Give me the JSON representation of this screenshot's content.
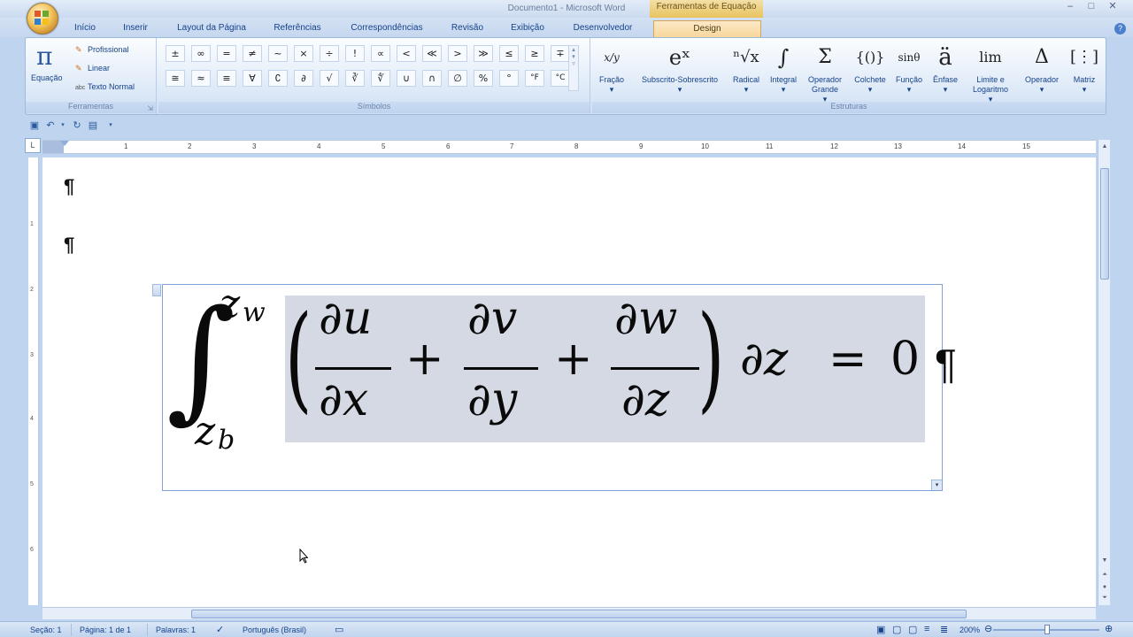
{
  "window": {
    "title": "Documento1 - Microsoft Word",
    "contextual_header": "Ferramentas de Equação",
    "controls": [
      "–",
      "□",
      "✕"
    ]
  },
  "tabs": [
    {
      "label": "Início"
    },
    {
      "label": "Inserir"
    },
    {
      "label": "Layout da Página"
    },
    {
      "label": "Referências"
    },
    {
      "label": "Correspondências"
    },
    {
      "label": "Revisão"
    },
    {
      "label": "Exibição"
    },
    {
      "label": "Desenvolvedor"
    },
    {
      "label": "Design"
    }
  ],
  "ribbon": {
    "tools": {
      "group_label": "Ferramentas",
      "equation_label": "Equação",
      "professional_label": "Profissional",
      "linear_label": "Linear",
      "normal_text_label": "Texto Normal",
      "normal_text_icon": "abc"
    },
    "symbols": {
      "group_label": "Símbolos",
      "row1": [
        "±",
        "∞",
        "=",
        "≠",
        "~",
        "×",
        "÷",
        "!",
        "∝",
        "<",
        "≪",
        ">",
        "≫",
        "≤",
        "≥",
        "∓"
      ],
      "row2": [
        "≅",
        "≈",
        "≡",
        "∀",
        "∁",
        "∂",
        "√",
        "∛",
        "∜",
        "∪",
        "∩",
        "∅",
        "%",
        "°",
        "°F",
        "°C"
      ]
    },
    "structures": {
      "group_label": "Estruturas",
      "items": [
        {
          "label": "Fração",
          "glyph": "x/y",
          "arrow": "▾"
        },
        {
          "label": "Subscrito-Sobrescrito",
          "glyph": "eˣ",
          "arrow": "▾"
        },
        {
          "label": "Radical",
          "glyph": "ⁿ√x",
          "arrow": "▾"
        },
        {
          "label": "Integral",
          "glyph": "∫",
          "arrow": "▾"
        },
        {
          "label": "Operador Grande",
          "glyph": "Σ",
          "arrow": "▾"
        },
        {
          "label": "Colchete",
          "glyph": "{()}",
          "arrow": "▾"
        },
        {
          "label": "Função",
          "glyph": "sinθ",
          "arrow": "▾"
        },
        {
          "label": "Ênfase",
          "glyph": "ä",
          "arrow": "▾"
        },
        {
          "label": "Limite e Logaritmo",
          "glyph": "lim",
          "arrow": "▾"
        },
        {
          "label": "Operador",
          "glyph": "Δ",
          "arrow": "▾"
        },
        {
          "label": "Matriz",
          "glyph": "[⋮]",
          "arrow": "▾"
        }
      ]
    }
  },
  "ruler": {
    "numbers": [
      "1",
      "2",
      "3",
      "4",
      "5",
      "6",
      "7",
      "8",
      "9",
      "10",
      "11",
      "12",
      "13",
      "14",
      "15"
    ],
    "vertical_numbers": [
      "1",
      "2",
      "3",
      "4",
      "5",
      "6"
    ],
    "corner": "L"
  },
  "document": {
    "paragraph_mark": "¶",
    "equation": {
      "integral_sign": "∫",
      "upper_limit": "z",
      "upper_limit_sub": "w",
      "lower_limit": "z",
      "lower_limit_sub": "b",
      "open_paren": "(",
      "close_paren": ")",
      "frac1_num": "∂u",
      "frac1_den": "∂x",
      "frac2_num": "∂v",
      "frac2_den": "∂y",
      "frac3_num": "∂w",
      "frac3_den": "∂z",
      "plus": "+",
      "differential": "∂z",
      "equals": "=",
      "rhs": "0",
      "end_mark": "¶"
    }
  },
  "statusbar": {
    "section": "Seção: 1",
    "page": "Página: 1 de 1",
    "words": "Palavras: 1",
    "language": "Português (Brasil)",
    "zoom": "200%"
  }
}
